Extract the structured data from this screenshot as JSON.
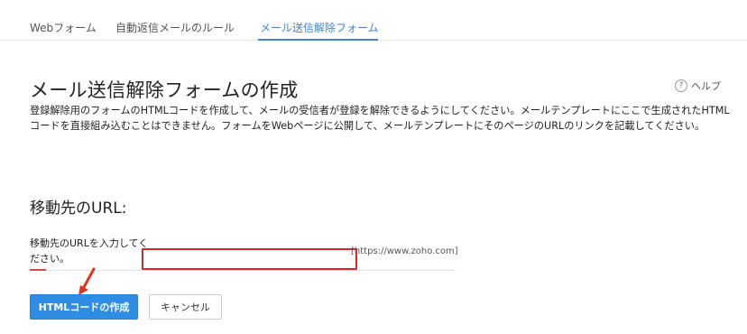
{
  "tabs": [
    {
      "label": "Webフォーム"
    },
    {
      "label": "自動返信メールのルール"
    },
    {
      "label": "メール送信解除フォーム"
    }
  ],
  "active_tab_index": 2,
  "page": {
    "title": "メール送信解除フォームの作成",
    "help_label": "ヘルプ",
    "help_icon": "question-circle-icon",
    "description": "登録解除用のフォームのHTMLコードを作成して、メールの受信者が登録を解除できるようにしてください。メールテンプレートにここで生成されたHTMLコードを直接組み込むことはできません。フォームをWebページに公開して、メールテンプレートにそのページのURLのリンクを記載してください。"
  },
  "redirect": {
    "section_title": "移動先のURL:",
    "field_label": "移動先のURLを入力してください。",
    "input_value": "",
    "example_hint": "[https://www.zoho.com]"
  },
  "buttons": {
    "create_html": "HTMLコードの作成",
    "cancel": "キャンセル"
  },
  "colors": {
    "accent": "#3f86d6",
    "primary_button": "#2f8de4",
    "highlight_red": "#d9262b"
  }
}
